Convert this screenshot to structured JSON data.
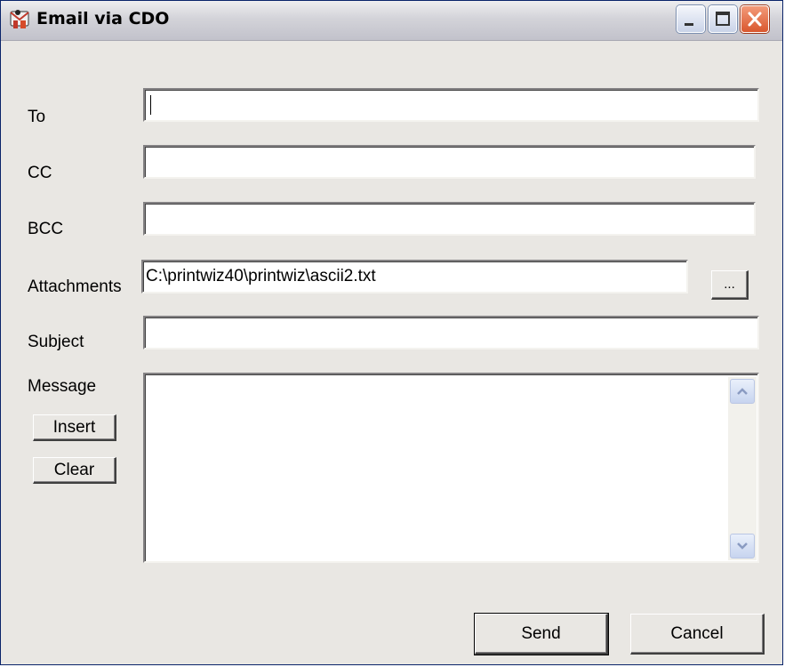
{
  "window": {
    "title": "Email via CDO"
  },
  "form": {
    "to_label": "To",
    "to_value": "",
    "cc_label": "CC",
    "cc_value": "",
    "bcc_label": "BCC",
    "bcc_value": "",
    "attachments_label": "Attachments",
    "attachments_value": "C:\\printwiz40\\printwiz\\ascii2.txt",
    "browse_label": "...",
    "subject_label": "Subject",
    "subject_value": "",
    "message_label": "Message",
    "message_value": "",
    "insert_label": "Insert",
    "clear_label": "Clear"
  },
  "buttons": {
    "send_label": "Send",
    "cancel_label": "Cancel"
  },
  "icons": {
    "app": "email-app-icon",
    "minimize": "minimize-icon",
    "maximize": "maximize-icon",
    "close": "close-icon",
    "scroll_up": "scroll-up-arrow-icon",
    "scroll_down": "scroll-down-arrow-icon"
  },
  "colors": {
    "window_bg": "#e9e7e3",
    "close_button": "#d9572e",
    "title_bar": "#d3d3d9"
  }
}
